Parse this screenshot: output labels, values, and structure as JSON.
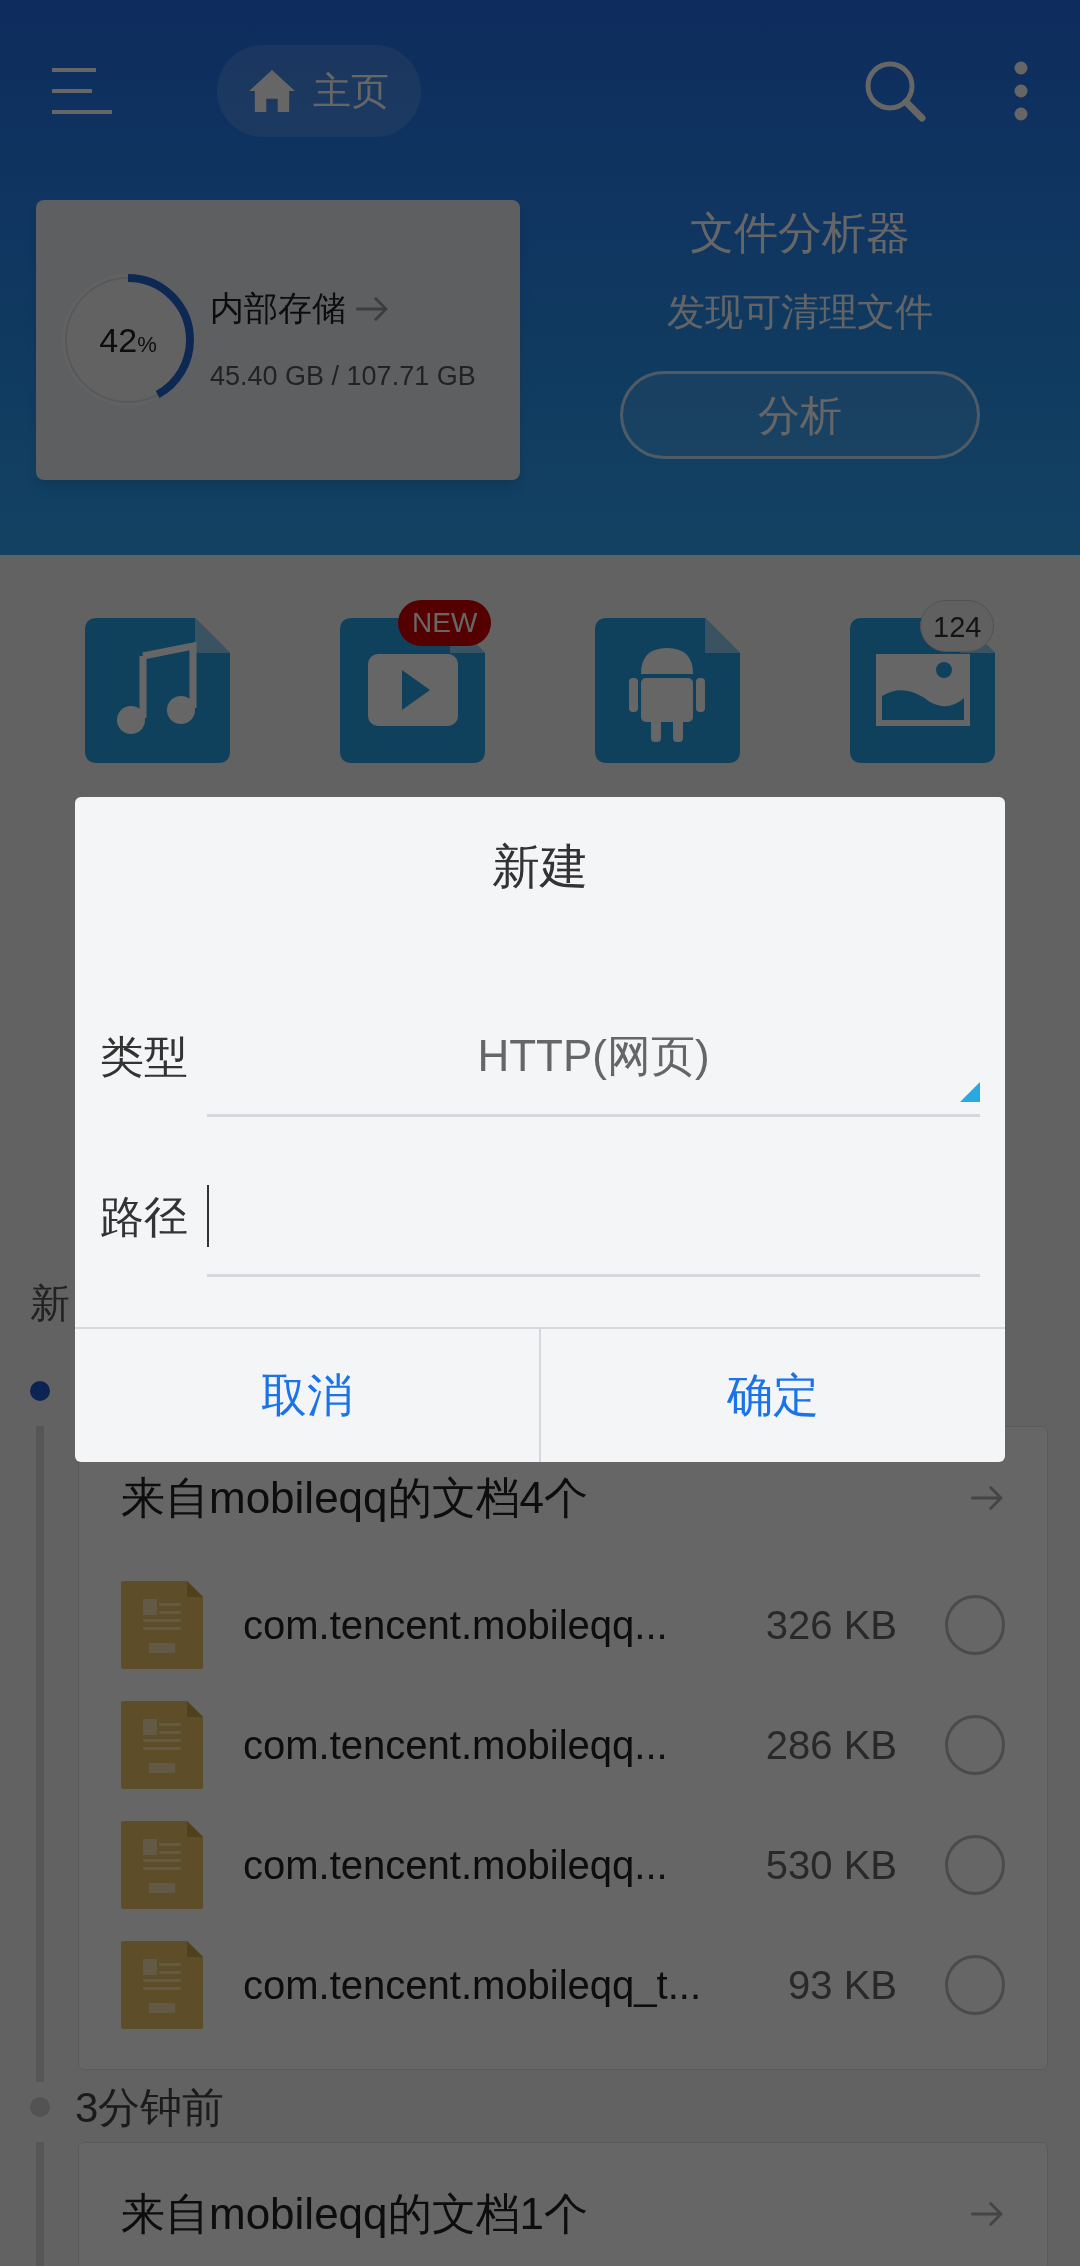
{
  "toolbar": {
    "title": "主页"
  },
  "storage": {
    "name": "内部存储",
    "percent": "42",
    "percent_unit": "%",
    "usage": "45.40 GB / 107.71 GB",
    "level": 0.42
  },
  "analyzer": {
    "title": "文件分析器",
    "subtitle": "发现可清理文件",
    "button": "分析"
  },
  "categories": [
    {
      "kind": "music"
    },
    {
      "kind": "video",
      "badge": "NEW"
    },
    {
      "kind": "app"
    },
    {
      "kind": "image",
      "badge": "124"
    }
  ],
  "section_heading": "新",
  "timeline": [
    {
      "active": true,
      "card": {
        "title": "来自mobileqq的文档4个",
        "files": [
          {
            "name": "com.tencent.mobileqq...",
            "size": "326 KB",
            "checked": false
          },
          {
            "name": "com.tencent.mobileqq...",
            "size": "286 KB",
            "checked": false
          },
          {
            "name": "com.tencent.mobileqq...",
            "size": "530 KB",
            "checked": false
          },
          {
            "name": "com.tencent.mobileqq_t...",
            "size": "93 KB",
            "checked": false
          }
        ]
      }
    },
    {
      "active": false,
      "time": "3分钟前",
      "card": {
        "title": "来自mobileqq的文档1个"
      }
    }
  ],
  "dialog": {
    "title": "新建",
    "fields": [
      {
        "kind": "select",
        "label": "类型",
        "value": "HTTP(网页)"
      },
      {
        "kind": "input",
        "label": "路径"
      }
    ],
    "buttons": [
      "取消",
      "确定"
    ]
  }
}
